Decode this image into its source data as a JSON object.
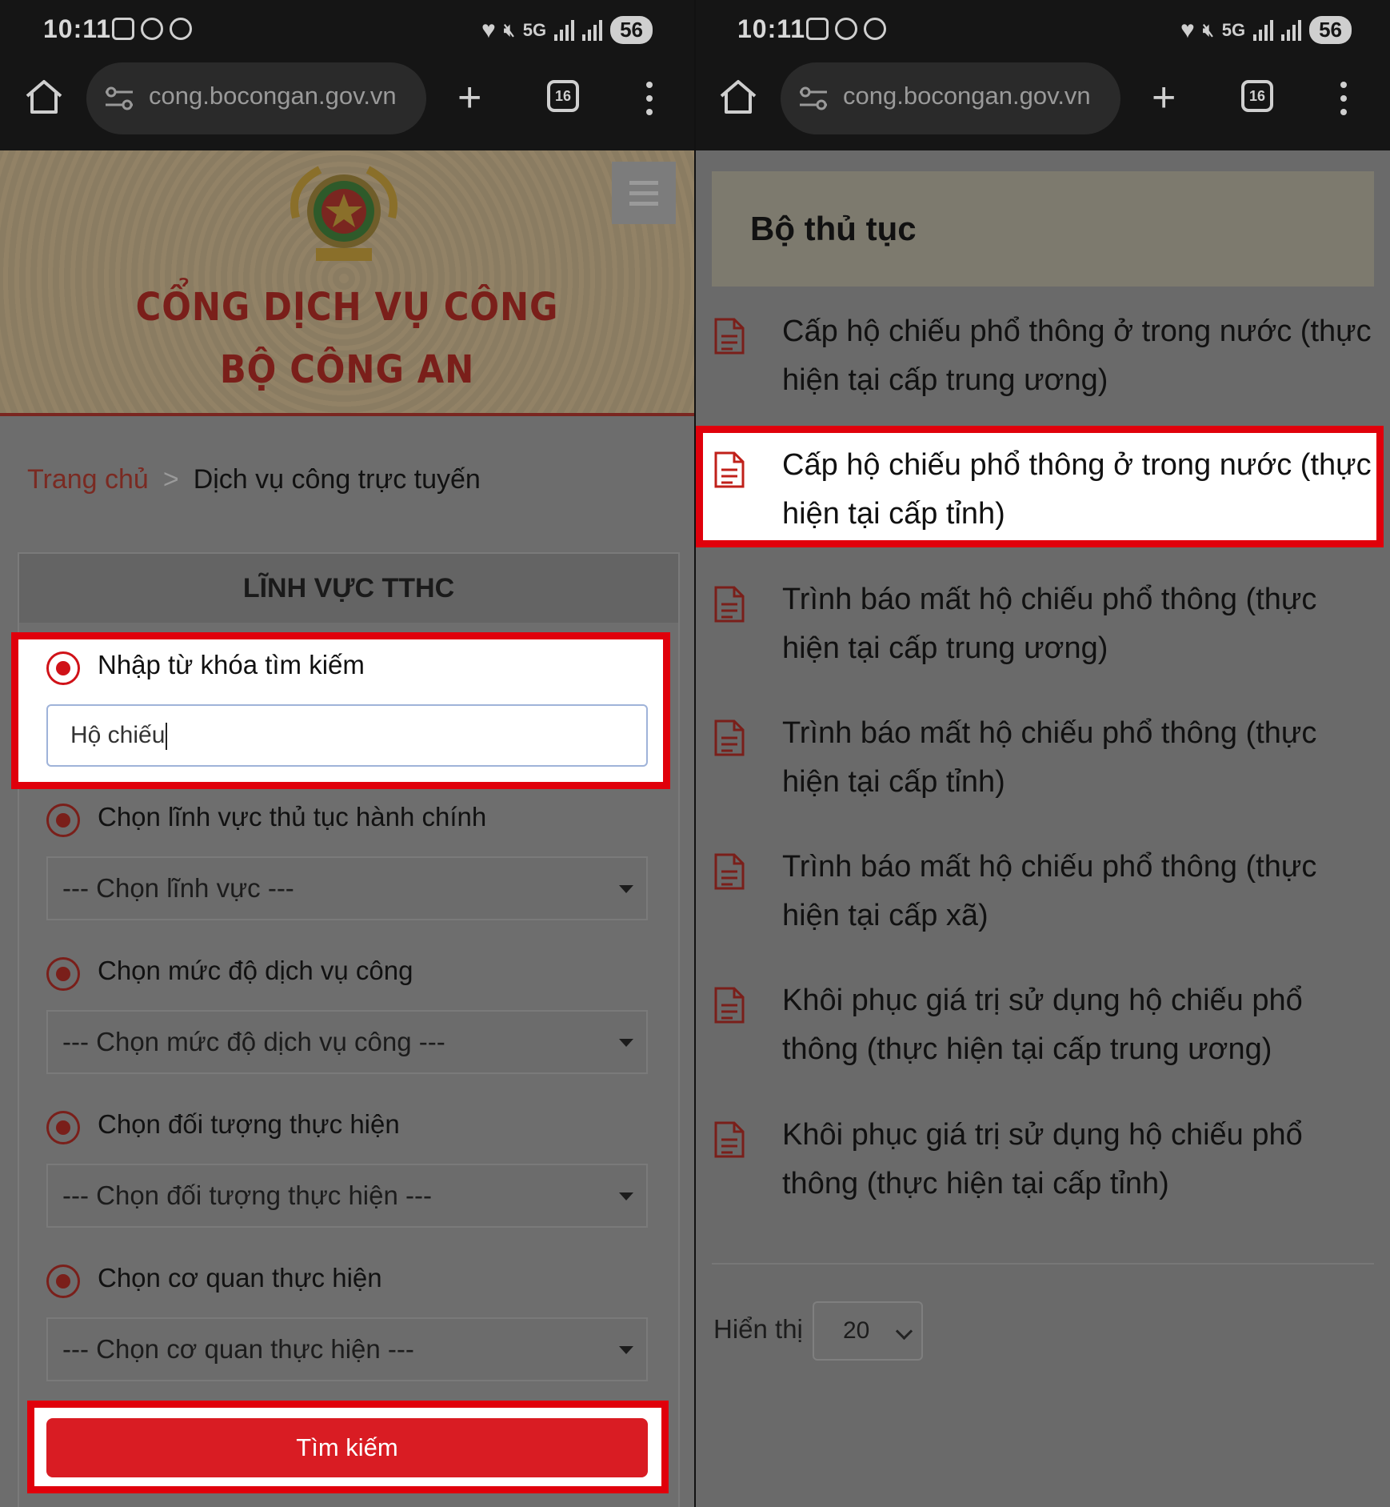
{
  "status_bar": {
    "time": "10:11",
    "battery": "56",
    "net": "5G"
  },
  "browser": {
    "url": "cong.bocongan.gov.vn",
    "tab_count": "16"
  },
  "left": {
    "banner": {
      "line1": "CỔNG DỊCH VỤ CÔNG",
      "line2": "BỘ CÔNG AN"
    },
    "breadcrumb": {
      "home": "Trang chủ",
      "separator": ">",
      "current": "Dịch vụ công trực tuyến"
    },
    "form": {
      "title": "LĨNH VỰC TTHC",
      "keyword_label": "Nhập từ khóa tìm kiếm",
      "keyword_value": "Hộ chiếu",
      "field_label": "Chọn lĩnh vực thủ tục hành chính",
      "field_select": "--- Chọn lĩnh vực ---",
      "level_label": "Chọn mức độ dịch vụ công",
      "level_select": "--- Chọn mức độ dịch vụ công ---",
      "subject_label": "Chọn đối tượng thực hiện",
      "subject_select": "--- Chọn đối tượng thực hiện ---",
      "agency_label": "Chọn cơ quan thực hiện",
      "agency_select": "--- Chọn cơ quan thực hiện ---",
      "search_button": "Tìm kiếm"
    }
  },
  "right": {
    "heading": "Bộ thủ tục",
    "procedures": [
      "Cấp hộ chiếu phổ thông ở trong nước (thực hiện tại cấp trung ương)",
      "Cấp hộ chiếu phổ thông ở trong nước (thực hiện tại cấp tỉnh)",
      "Trình báo mất hộ chiếu phổ thông (thực hiện tại cấp trung ương)",
      "Trình báo mất hộ chiếu phổ thông (thực hiện tại cấp tỉnh)",
      "Trình báo mất hộ chiếu phổ thông (thực hiện tại cấp xã)",
      "Khôi phục giá trị sử dụng hộ chiếu phổ thông (thực hiện tại cấp trung ương)",
      "Khôi phục giá trị sử dụng hộ chiếu phổ thông (thực hiện tại cấp tỉnh)"
    ],
    "show_label": "Hiển thị",
    "page_size": "20"
  },
  "colors": {
    "highlight": "#e0000b",
    "brand_red": "#d91c23",
    "title_red": "#7a1f1a"
  }
}
